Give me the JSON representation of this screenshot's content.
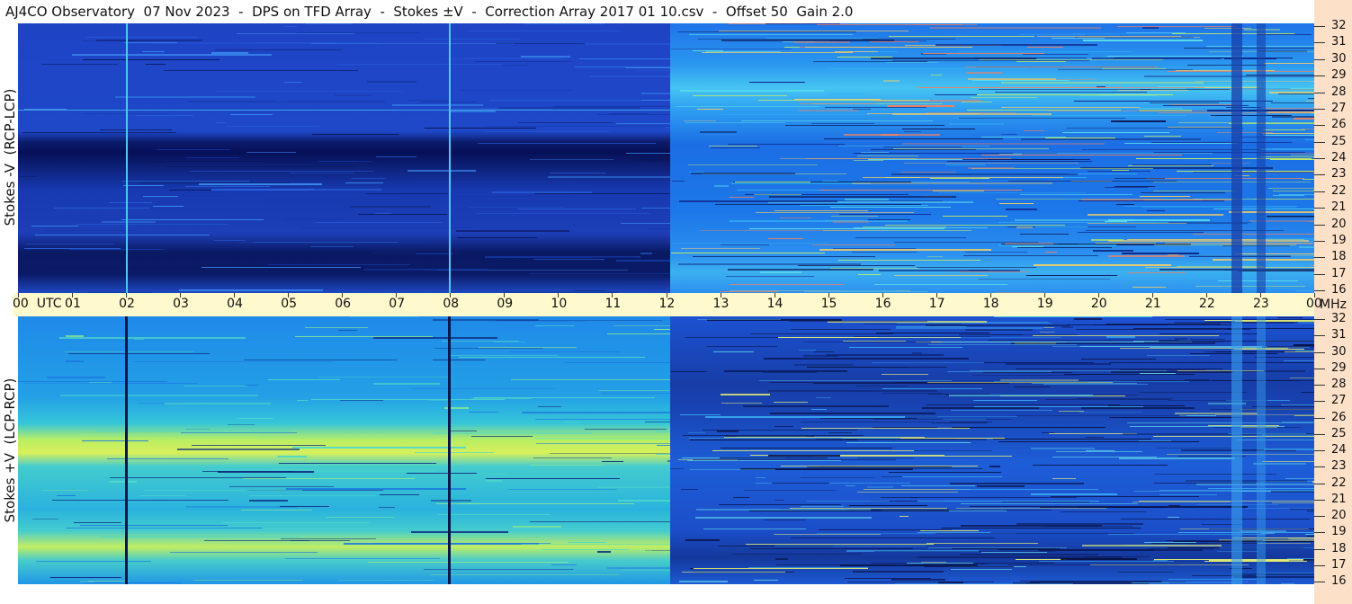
{
  "title": "AJ4CO Observatory  07 Nov 2023  -  DPS on TFD Array  -  Stokes ±V  -  Correction Array 2017 01 10.csv  -  Offset 50  Gain 2.0",
  "colors": {
    "axis_band": "#fffacd",
    "side_band": "#fde0c8",
    "text": "#111111"
  },
  "chart_data": [
    {
      "type": "heatmap",
      "panel": "top",
      "ylabel": "Stokes -V  (RCP-LCP)",
      "x_axis": {
        "ticks": [
          "00  UTC",
          "01",
          "02",
          "03",
          "04",
          "05",
          "06",
          "07",
          "08",
          "09",
          "10",
          "11",
          "12",
          "13",
          "14",
          "15",
          "16",
          "17",
          "18",
          "19",
          "20",
          "21",
          "22",
          "23",
          "00"
        ],
        "range_hours": [
          0,
          24
        ]
      },
      "y_axis": {
        "unit": "MHz",
        "ticks": [
          32,
          31,
          30,
          29,
          28,
          27,
          26,
          25,
          24,
          23,
          22,
          21,
          20,
          19,
          18,
          17,
          16
        ],
        "range": [
          16,
          32
        ]
      },
      "regimes": [
        {
          "x_hours": [
            0,
            12.1
          ],
          "intensity": "low",
          "dark_bands_mhz": [
            [
              24.3,
              25.0
            ],
            [
              17.5,
              19.0
            ]
          ]
        },
        {
          "x_hours": [
            12.1,
            24
          ],
          "intensity": "high",
          "active_bands_mhz": [
            [
              27.0,
              29.0
            ],
            [
              17.5,
              18.5
            ]
          ]
        }
      ],
      "vertical_lines_hours": [
        2.0,
        8.0
      ],
      "dark_column_hours": [
        22.6,
        23.2
      ]
    },
    {
      "type": "heatmap",
      "panel": "bottom",
      "ylabel": "Stokes +V  (LCP-RCP)",
      "x_axis": {
        "ticks": [
          "00  UTC",
          "01",
          "02",
          "03",
          "04",
          "05",
          "06",
          "07",
          "08",
          "09",
          "10",
          "11",
          "12",
          "13",
          "14",
          "15",
          "16",
          "17",
          "18",
          "19",
          "20",
          "21",
          "22",
          "23",
          "00"
        ],
        "range_hours": [
          0,
          24
        ]
      },
      "y_axis": {
        "unit": "MHz",
        "ticks": [
          32,
          31,
          30,
          29,
          28,
          27,
          26,
          25,
          24,
          23,
          22,
          21,
          20,
          19,
          18,
          17,
          16
        ],
        "range": [
          16,
          32
        ]
      },
      "regimes": [
        {
          "x_hours": [
            0,
            12.1
          ],
          "intensity": "high",
          "bright_bands_mhz": [
            [
              24.0,
              25.2
            ],
            [
              17.5,
              18.6
            ]
          ]
        },
        {
          "x_hours": [
            12.1,
            24
          ],
          "intensity": "low",
          "active_bands_mhz": [
            [
              26.5,
              29.0
            ],
            [
              16.5,
              18.5
            ]
          ]
        }
      ],
      "vertical_lines_hours": [
        2.0,
        8.0
      ],
      "light_column_hours": [
        22.6,
        23.2
      ]
    }
  ],
  "freq_unit": "MHz"
}
